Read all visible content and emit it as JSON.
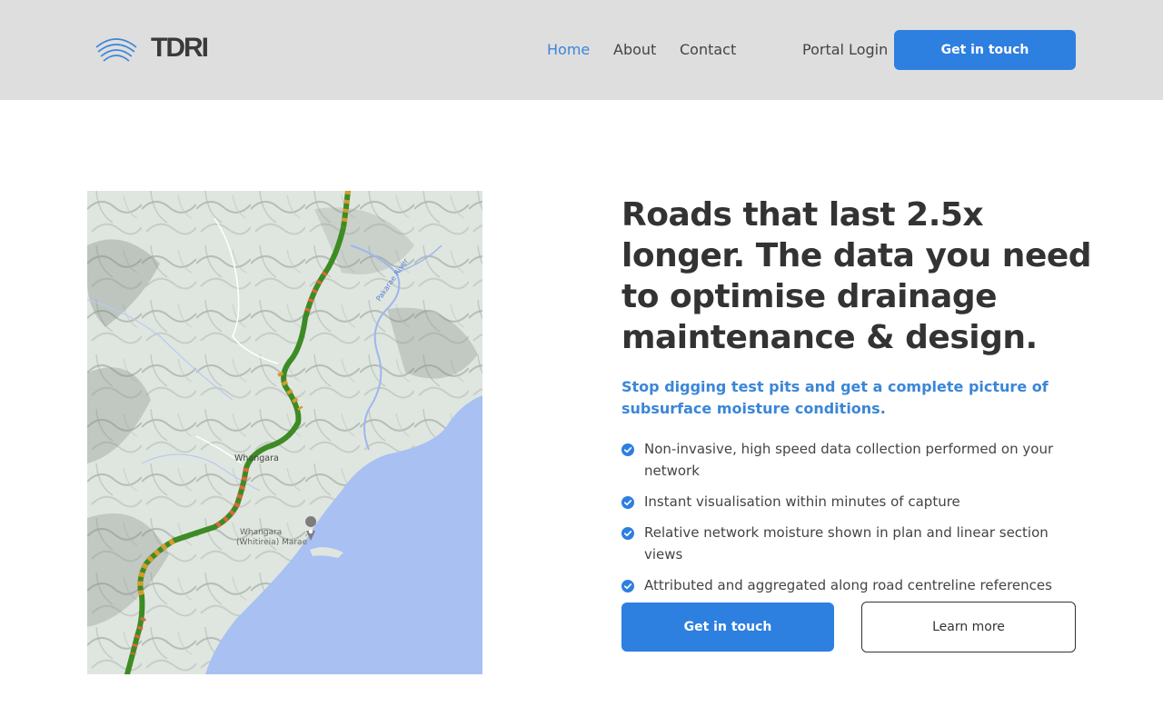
{
  "brand": {
    "name": "TDRI",
    "logo_icon": "signal-arcs-icon"
  },
  "nav": {
    "items": [
      {
        "label": "Home",
        "active": true
      },
      {
        "label": "About",
        "active": false
      },
      {
        "label": "Contact",
        "active": false
      }
    ],
    "portal_login": "Portal Login",
    "cta": "Get in touch"
  },
  "hero": {
    "headline": "Roads that last 2.5x longer. The data you need to optimise drainage maintenance & design.",
    "subheadline": "Stop digging test pits and get a complete picture of subsurface moisture conditions.",
    "features": [
      "Non-invasive, high speed data collection performed on your network",
      "Instant visualisation within minutes of capture",
      "Relative network moisture shown in plan and linear section views",
      "Attributed and aggregated along road centreline references"
    ],
    "primary_button": "Get in touch",
    "secondary_button": "Learn more"
  },
  "map": {
    "labels": {
      "town": "Whangara",
      "marae": "Whangara (Whitireia) Marae",
      "river": "Pakarae River"
    },
    "colors": {
      "road_good": "#3d8b24",
      "road_moderate": "#d89a2a",
      "road_wet": "#e0663a",
      "sea": "#a8c0f2",
      "land": "#dfe6e0"
    }
  },
  "colors": {
    "accent": "#2d7fe0",
    "link_active": "#3a86d8",
    "header_bg": "#dedede",
    "text": "#333333"
  }
}
